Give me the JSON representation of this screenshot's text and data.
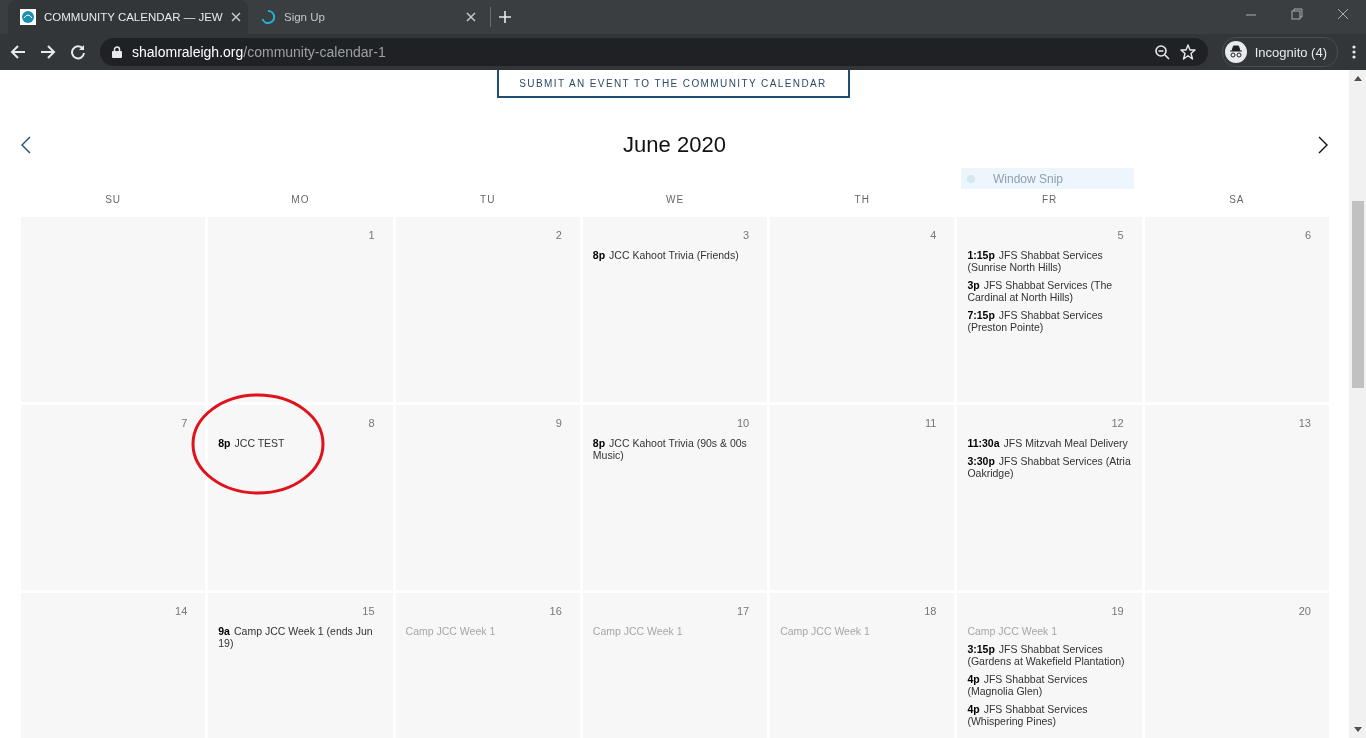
{
  "browser": {
    "tabs": [
      {
        "title": "COMMUNITY CALENDAR — JEW",
        "selected": true
      },
      {
        "title": "Sign Up",
        "selected": false
      }
    ],
    "address": {
      "domain": "shalomraleigh.org",
      "path": "/community-calendar-1"
    },
    "profile": "Incognito (4)"
  },
  "page": {
    "submit_button": "SUBMIT AN EVENT TO THE COMMUNITY CALENDAR",
    "month_title": "June 2020",
    "overlay_tooltip": "Window Snip",
    "weekdays": [
      "SU",
      "MO",
      "TU",
      "WE",
      "TH",
      "FR",
      "SA"
    ],
    "weeks": [
      {
        "days": [
          {
            "kind": "blank"
          },
          {
            "number": "1"
          },
          {
            "number": "2"
          },
          {
            "number": "3",
            "events": [
              {
                "kind": "event",
                "time": "8p",
                "title": "JCC Kahoot Trivia (Friends)"
              }
            ]
          },
          {
            "number": "4"
          },
          {
            "number": "5",
            "events": [
              {
                "kind": "event",
                "time": "1:15p",
                "title": "JFS Shabbat Services (Sunrise North Hills)"
              },
              {
                "kind": "event",
                "time": "3p",
                "title": "JFS Shabbat Services (The Cardinal at North Hills)"
              },
              {
                "kind": "event",
                "time": "7:15p",
                "title": "JFS Shabbat Services (Preston Pointe)"
              }
            ]
          },
          {
            "number": "6"
          }
        ]
      },
      {
        "days": [
          {
            "number": "7"
          },
          {
            "number": "8",
            "circled": true,
            "events": [
              {
                "kind": "event",
                "time": "8p",
                "title": "JCC TEST"
              }
            ]
          },
          {
            "number": "9"
          },
          {
            "number": "10",
            "events": [
              {
                "kind": "event",
                "time": "8p",
                "title": "JCC Kahoot Trivia (90s & 00s Music)"
              }
            ]
          },
          {
            "number": "11"
          },
          {
            "number": "12",
            "events": [
              {
                "kind": "event",
                "time": "11:30a",
                "title": "JFS Mitzvah Meal Delivery"
              },
              {
                "kind": "event",
                "time": "3:30p",
                "title": "JFS Shabbat Services (Atria Oakridge)"
              }
            ]
          },
          {
            "number": "13"
          }
        ]
      },
      {
        "days": [
          {
            "number": "14"
          },
          {
            "number": "15",
            "events": [
              {
                "kind": "event",
                "time": "9a",
                "title": "Camp JCC Week 1 (ends  Jun 19)"
              }
            ]
          },
          {
            "number": "16",
            "events": [
              {
                "kind": "continuation",
                "title": "Camp JCC Week 1"
              }
            ]
          },
          {
            "number": "17",
            "events": [
              {
                "kind": "continuation",
                "title": "Camp JCC Week 1"
              }
            ]
          },
          {
            "number": "18",
            "events": [
              {
                "kind": "continuation",
                "title": "Camp JCC Week 1"
              }
            ]
          },
          {
            "number": "19",
            "events": [
              {
                "kind": "continuation",
                "title": "Camp JCC Week 1"
              },
              {
                "kind": "event",
                "time": "3:15p",
                "title": "JFS Shabbat Services (Gardens at Wakefield Plantation)"
              },
              {
                "kind": "event",
                "time": "4p",
                "title": "JFS Shabbat Services (Magnolia Glen)"
              },
              {
                "kind": "event",
                "time": "4p",
                "title": "JFS Shabbat Services (Whispering Pines)"
              }
            ]
          },
          {
            "number": "20"
          }
        ]
      }
    ]
  }
}
